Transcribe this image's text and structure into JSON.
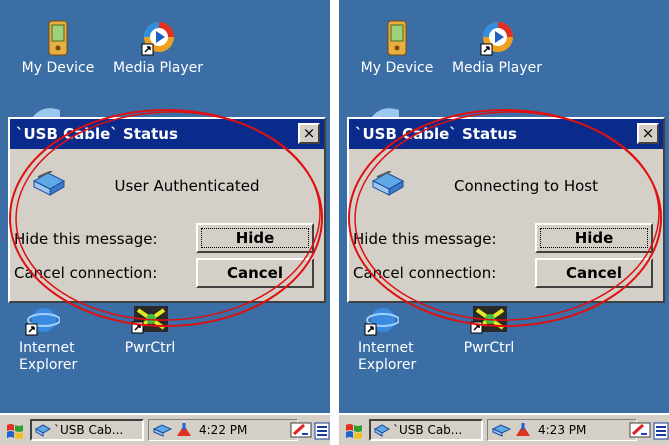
{
  "screens": [
    {
      "desktop": {
        "my_device": "My Device",
        "media_player": "Media Player",
        "internet_explorer": "Internet\nExplorer",
        "pwrctrl": "PwrCtrl"
      },
      "dialog": {
        "title": "`USB Cable` Status",
        "close": "×",
        "status_text": "User Authenticated",
        "hide_label": "Hide this message:",
        "hide_button": "Hide",
        "cancel_label": "Cancel connection:",
        "cancel_button": "Cancel"
      },
      "taskbar": {
        "task_label": "`USB Cab...",
        "clock": "4:22 PM"
      }
    },
    {
      "desktop": {
        "my_device": "My Device",
        "media_player": "Media Player",
        "internet_explorer": "Internet\nExplorer",
        "pwrctrl": "PwrCtrl"
      },
      "dialog": {
        "title": "`USB Cable` Status",
        "close": "×",
        "status_text": "Connecting to Host",
        "hide_label": "Hide this message:",
        "hide_button": "Hide",
        "cancel_label": "Cancel connection:",
        "cancel_button": "Cancel"
      },
      "taskbar": {
        "task_label": "`USB Cab...",
        "clock": "4:23 PM"
      }
    }
  ],
  "colors": {
    "desktop": "#3a6ea5",
    "titlebar": "#0a2a8c",
    "annotation": "#e01010"
  }
}
